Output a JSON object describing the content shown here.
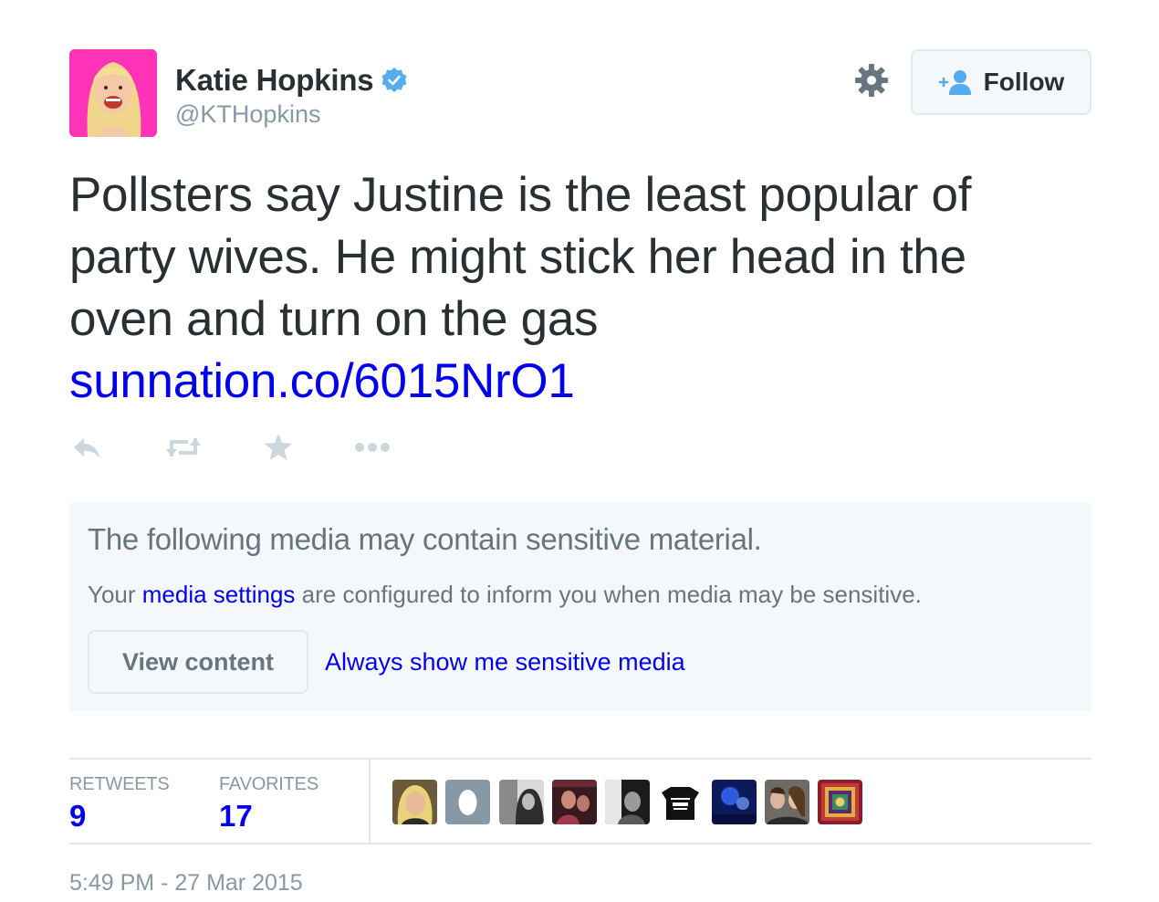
{
  "user": {
    "display_name": "Katie Hopkins",
    "handle": "@KTHopkins",
    "verified_icon": "verified-badge-icon",
    "avatar_icon": "avatar-image"
  },
  "header": {
    "settings_icon": "gear-icon",
    "follow_label": "Follow",
    "follow_icon": "add-user-icon"
  },
  "tweet": {
    "text": "Pollsters say Justine is the least popular of party wives. He might stick her head in the oven and turn on the gas",
    "link": "sunnation.co/6015NrO1"
  },
  "actions": [
    {
      "icon": "reply-icon"
    },
    {
      "icon": "retweet-icon"
    },
    {
      "icon": "favorite-star-icon"
    },
    {
      "icon": "more-dots-icon"
    }
  ],
  "sensitive": {
    "title": "The following media may contain sensitive material.",
    "desc_before": "Your ",
    "desc_link": "media settings",
    "desc_after": " are configured to inform you when media may be sensitive.",
    "view_button": "View content",
    "always_link": "Always show me sensitive media"
  },
  "stats": {
    "retweets_label": "RETWEETS",
    "retweets_value": "9",
    "favorites_label": "FAVORITES",
    "favorites_value": "17"
  },
  "timestamp": "5:49 PM - 27 Mar 2015",
  "colors": {
    "link": "#0000ee",
    "muted": "#8899a6",
    "text": "#292f33",
    "verified": "#55acee",
    "box_bg": "#f5f8fa",
    "border": "#e1e8ed"
  }
}
